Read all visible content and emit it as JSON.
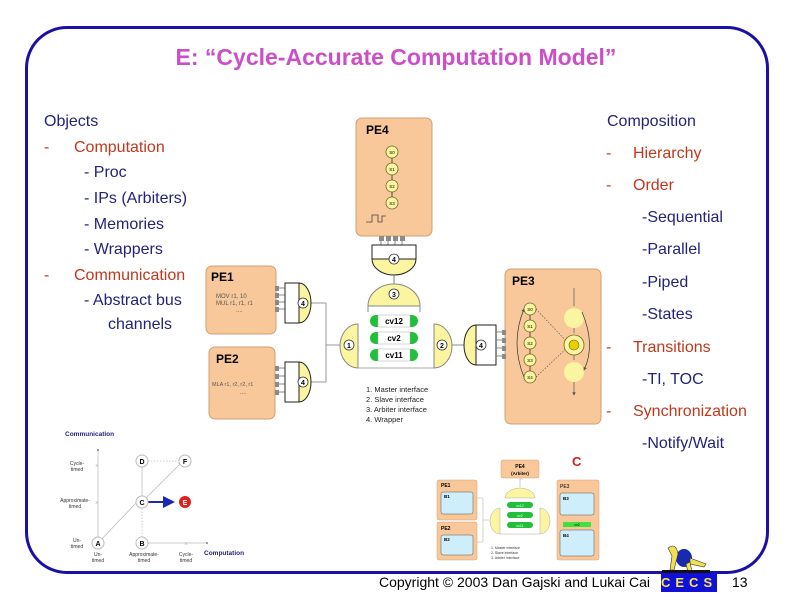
{
  "slide": {
    "title": "E: “Cycle-Accurate Computation Model”",
    "page_number": "13",
    "copyright": "Copyright © 2003 Dan Gajski and Lukai Cai",
    "logo_text": "CECS"
  },
  "objects": {
    "heading": "Objects",
    "bullet": "-",
    "items": [
      {
        "label": "Computation",
        "children": [
          "- Proc",
          "- IPs (Arbiters)",
          "- Memories",
          "- Wrappers"
        ]
      },
      {
        "label": "Communication",
        "children": [
          "- Abstract bus",
          "channels"
        ]
      }
    ]
  },
  "composition": {
    "heading": "Composition",
    "bullet": "-",
    "items": [
      {
        "label": "Hierarchy",
        "children": []
      },
      {
        "label": "Order",
        "children": [
          "-Sequential",
          "-Parallel",
          "-Piped",
          "-States"
        ]
      },
      {
        "label": "Transitions",
        "children": [
          "-TI, TOC"
        ]
      },
      {
        "label": "Synchronization",
        "children": [
          "-Notify/Wait"
        ]
      }
    ]
  },
  "main_diagram": {
    "pe4": {
      "label": "PE4",
      "states": [
        "S0",
        "S1",
        "S2",
        "S3"
      ]
    },
    "pe1": {
      "label": "PE1",
      "code": [
        "MOV   r1, 10",
        "MUL   r1, r1, r1",
        "...."
      ]
    },
    "pe2": {
      "label": "PE2",
      "code": [
        "MLA      r1, r2, r2, r1",
        "...."
      ]
    },
    "pe3": {
      "label": "PE3",
      "states": [
        "S0",
        "S1",
        "S2",
        "S3",
        "S4"
      ]
    },
    "channels": [
      "cv12",
      "cv2",
      "cv11"
    ],
    "interface_numbers": {
      "master": "1",
      "slave": "2",
      "arbiter": "3",
      "wrapper": "4"
    },
    "legend": [
      "1. Master interface",
      "2. Slave interface",
      "3. Arbiter interface",
      "4. Wrapper"
    ]
  },
  "model_graph": {
    "y_axis_label": "Communication",
    "x_axis_label": "Computation",
    "y_ticks": [
      "Un-\ntimed",
      "Approximate-\ntimed",
      "Cycle-\ntimed"
    ],
    "x_ticks": [
      "Un-\ntimed",
      "Approximate-\ntimed",
      "Cycle-\ntimed"
    ],
    "nodes": [
      "A",
      "B",
      "C",
      "D",
      "E",
      "F"
    ],
    "highlighted_node": "E",
    "highlight_color": "#e02020"
  },
  "thumbnail": {
    "marker": "C",
    "pe4": "PE4\n(Arbiter)",
    "pe1": "PE1",
    "b1": "B1",
    "pe2": "PE2",
    "b2": "B2",
    "pe3": "PE3",
    "b3": "B3",
    "b4": "B4",
    "channels": [
      "cv12",
      "cv2",
      "cv11"
    ],
    "mid_channel": "cv2",
    "legend": [
      "1. Master interface",
      "2. Slave interface",
      "3. Arbiter interface"
    ]
  },
  "colors": {
    "frame": "#1a10a8",
    "title": "#cc4fc8",
    "text_primary": "#23237a",
    "text_accent": "#c0381c",
    "pe_fill": "#f8c89a",
    "interface_fill": "#fbf4a0",
    "channel_green": "#22c03a"
  }
}
